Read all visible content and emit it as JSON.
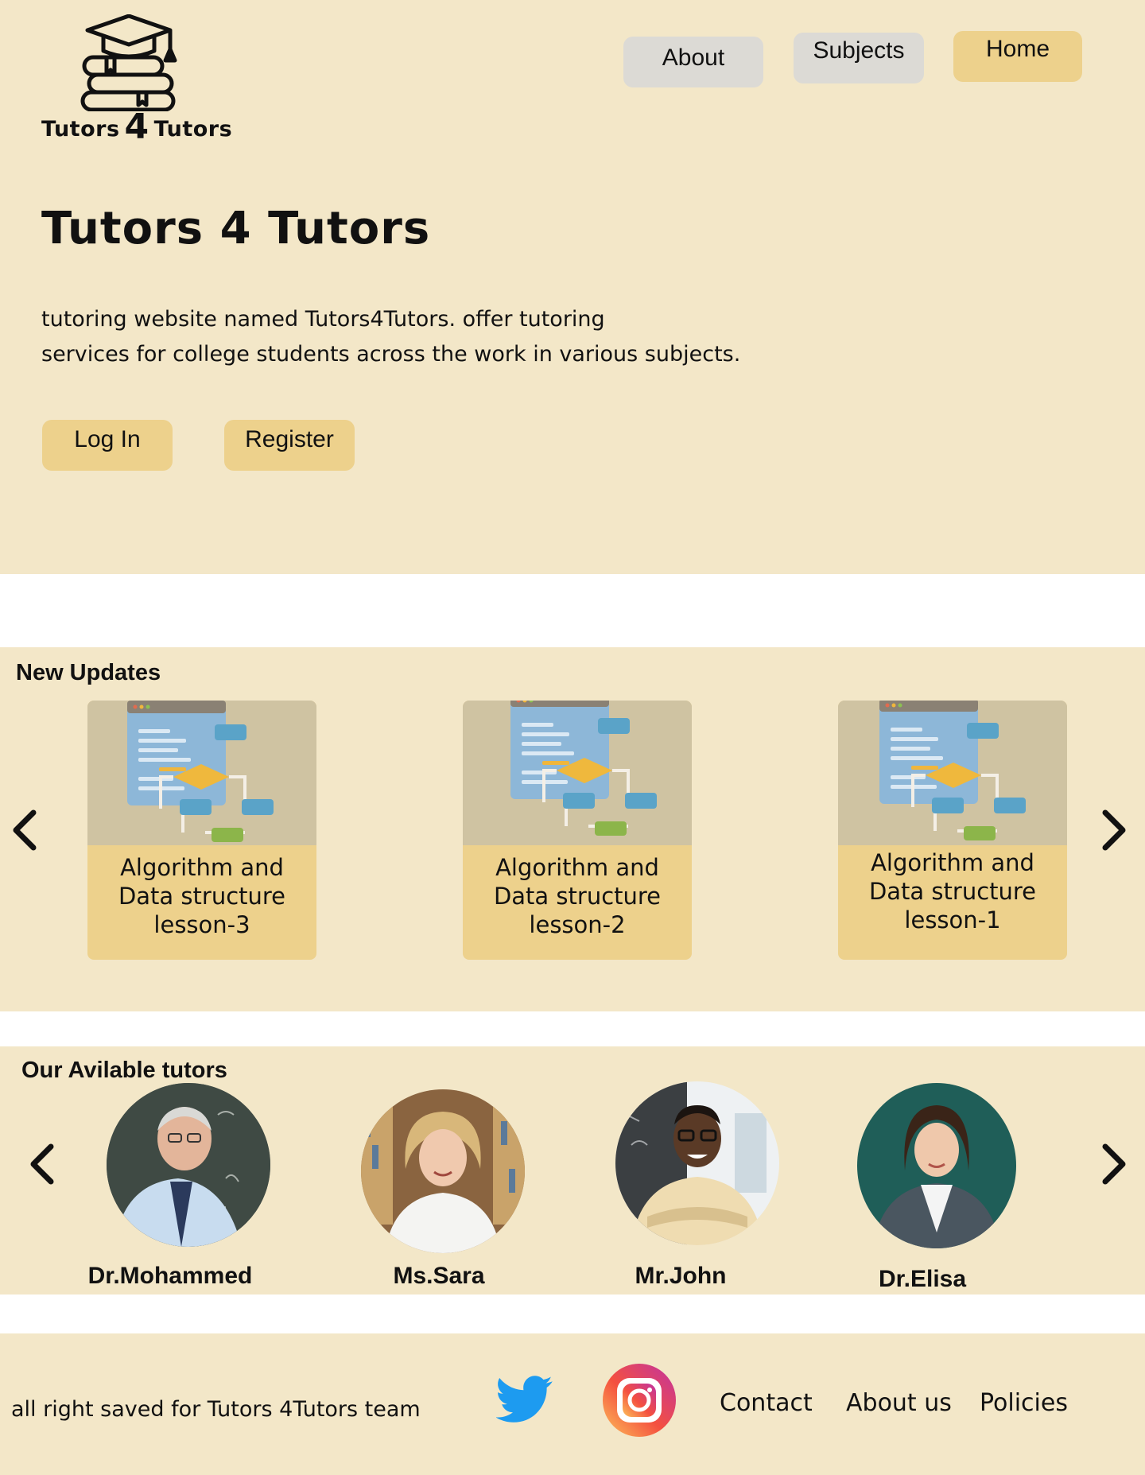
{
  "header": {
    "logo_text_left": "Tutors",
    "logo_text_mid": "4",
    "logo_text_right": "Tutors",
    "nav": {
      "about": "About",
      "subjects": "Subjects",
      "home": "Home"
    }
  },
  "hero": {
    "title": "Tutors 4 Tutors",
    "description_line1": "tutoring website named Tutors4Tutors. offer tutoring",
    "description_line2": "services for college students across the work in various subjects.",
    "login_label": "Log In",
    "register_label": "Register"
  },
  "updates": {
    "title": "New Updates",
    "cards": [
      {
        "line1": "Algorithm and",
        "line2": "Data structure",
        "line3": "lesson-3"
      },
      {
        "line1": "Algorithm and",
        "line2": "Data structure",
        "line3": "lesson-2"
      },
      {
        "line1": "Algorithm and",
        "line2": "Data structure",
        "line3": "lesson-1"
      }
    ]
  },
  "tutors": {
    "title": "Our Avilable tutors",
    "list": [
      {
        "name": "Dr.Mohammed"
      },
      {
        "name": "Ms.Sara"
      },
      {
        "name": "Mr.John"
      },
      {
        "name": "Dr.Elisa"
      }
    ]
  },
  "footer": {
    "copyright": "all right saved for Tutors 4Tutors team",
    "links": {
      "contact": "Contact",
      "about_us": "About us",
      "policies": "Policies"
    },
    "icons": [
      "twitter-icon",
      "instagram-icon"
    ]
  },
  "colors": {
    "section_bg": "#f3e7c8",
    "accent_gold": "#edd18c",
    "nav_gray": "#dcdad5",
    "twitter_blue": "#1d9bf0"
  }
}
